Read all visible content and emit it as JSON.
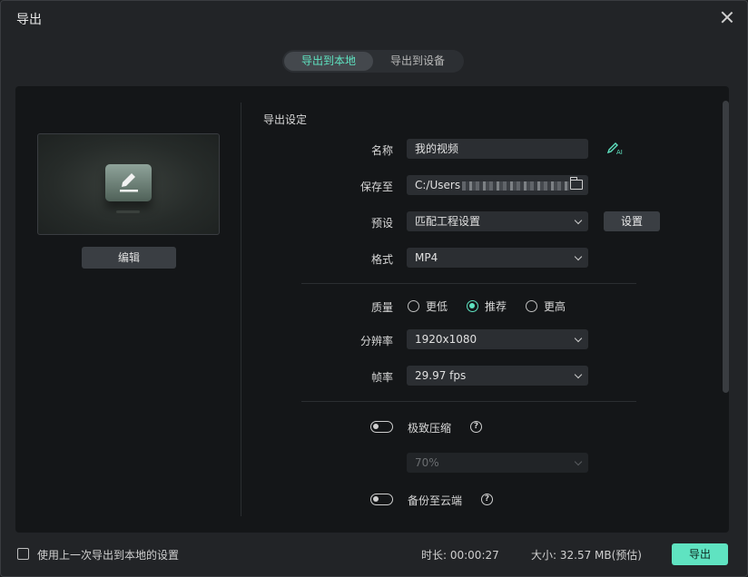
{
  "window": {
    "title": "导出"
  },
  "tabs": [
    {
      "label": "导出到本地",
      "active": true
    },
    {
      "label": "导出到设备",
      "active": false
    }
  ],
  "preview": {
    "edit_label": "编辑"
  },
  "settings": {
    "section_title": "导出设定",
    "name": {
      "label": "名称",
      "value": "我的视频"
    },
    "save_to": {
      "label": "保存至",
      "value": "C:/Users"
    },
    "preset": {
      "label": "预设",
      "value": "匹配工程设置",
      "button": "设置"
    },
    "format": {
      "label": "格式",
      "value": "MP4"
    },
    "quality": {
      "label": "质量",
      "options": [
        "更低",
        "推荐",
        "更高"
      ],
      "selected": "推荐"
    },
    "resolution": {
      "label": "分辨率",
      "value": "1920x1080"
    },
    "framerate": {
      "label": "帧率",
      "value": "29.97 fps"
    },
    "compress": {
      "label": "极致压缩",
      "enabled": false,
      "value": "70%"
    },
    "cloud": {
      "label": "备份至云端",
      "enabled": false
    }
  },
  "footer": {
    "remember_label": "使用上一次导出到本地的设置",
    "duration": "时长:  00:00:27",
    "size": "大小:  32.57 MB(预估)",
    "export_label": "导出"
  },
  "colors": {
    "accent": "#5fe3c1",
    "panel": "#141618",
    "window": "#222427"
  }
}
